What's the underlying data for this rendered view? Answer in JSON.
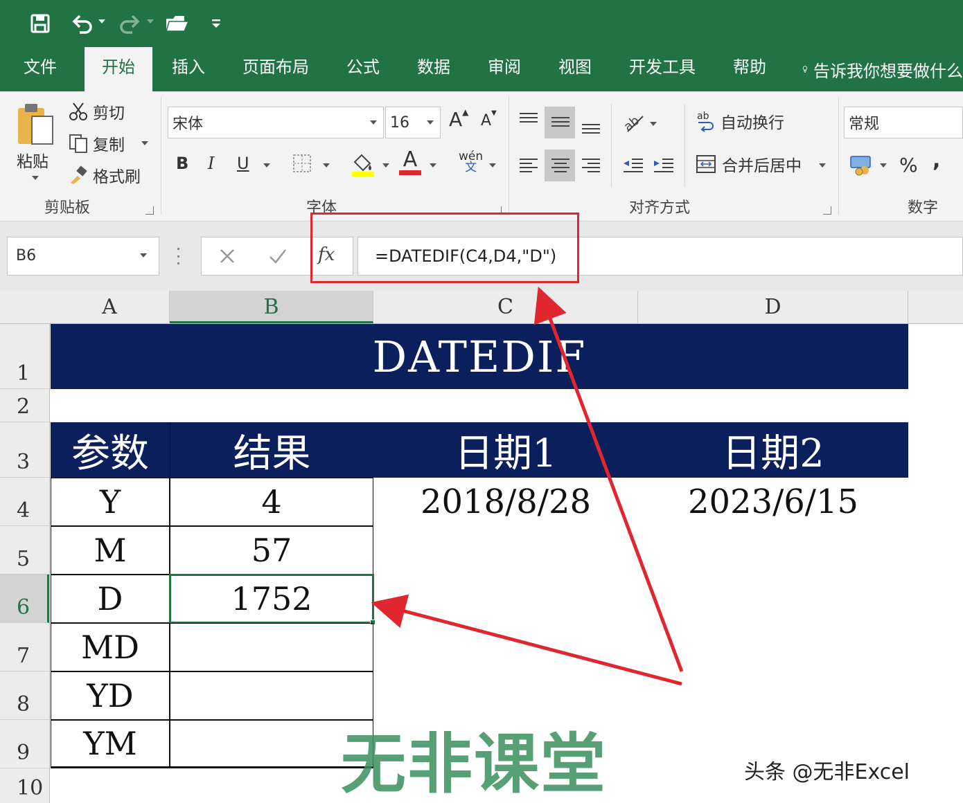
{
  "quick_access": {
    "icons": [
      "save-icon",
      "undo-icon",
      "redo-icon",
      "open-folder-icon",
      "customize-icon"
    ]
  },
  "tabs": [
    {
      "label": "文件"
    },
    {
      "label": "开始",
      "active": true
    },
    {
      "label": "插入"
    },
    {
      "label": "页面布局"
    },
    {
      "label": "公式"
    },
    {
      "label": "数据"
    },
    {
      "label": "审阅"
    },
    {
      "label": "视图"
    },
    {
      "label": "开发工具"
    },
    {
      "label": "帮助"
    }
  ],
  "tell_me": "告诉我你想要做什么",
  "ribbon": {
    "clipboard": {
      "paste": "粘贴",
      "cut": "剪切",
      "copy": "复制",
      "format_painter": "格式刷",
      "group_label": "剪贴板"
    },
    "font": {
      "font_name": "宋体",
      "font_size": "16",
      "bold": "B",
      "italic": "I",
      "underline": "U",
      "increase_size": "A",
      "decrease_size": "A",
      "phonetic": "wén",
      "phonetic_sub": "文",
      "font_color_glyph": "A",
      "group_label": "字体",
      "highlight_color": "#ffff00",
      "font_color": "#e0262f"
    },
    "alignment": {
      "wrap_text": "自动换行",
      "merge_center": "合并后居中",
      "group_label": "对齐方式"
    },
    "number": {
      "format": "常规",
      "percent": "%",
      "comma": ",",
      "group_label": "数字"
    }
  },
  "formula_bar": {
    "name_box": "B6",
    "fx_label": "fx",
    "formula": "=DATEDIF(C4,D4,\"D\")"
  },
  "columns": [
    "A",
    "B",
    "C",
    "D"
  ],
  "rows": [
    "1",
    "2",
    "3",
    "4",
    "5",
    "6",
    "7",
    "8",
    "9",
    "10"
  ],
  "sheet": {
    "title": "DATEDIF",
    "header_param": "参数",
    "header_result": "结果",
    "header_date1": "日期1",
    "header_date2": "日期2",
    "date1": "2018/8/28",
    "date2": "2023/6/15",
    "table": [
      {
        "param": "Y",
        "result": "4"
      },
      {
        "param": "M",
        "result": "57"
      },
      {
        "param": "D",
        "result": "1752"
      },
      {
        "param": "MD",
        "result": ""
      },
      {
        "param": "YD",
        "result": ""
      },
      {
        "param": "YM",
        "result": ""
      }
    ],
    "header_color": "#0b1f5c"
  },
  "watermark": "无非课堂",
  "byline": "头条 @无非Excel",
  "colors": {
    "excel_green": "#217346",
    "annotation_red": "#e0262f"
  }
}
